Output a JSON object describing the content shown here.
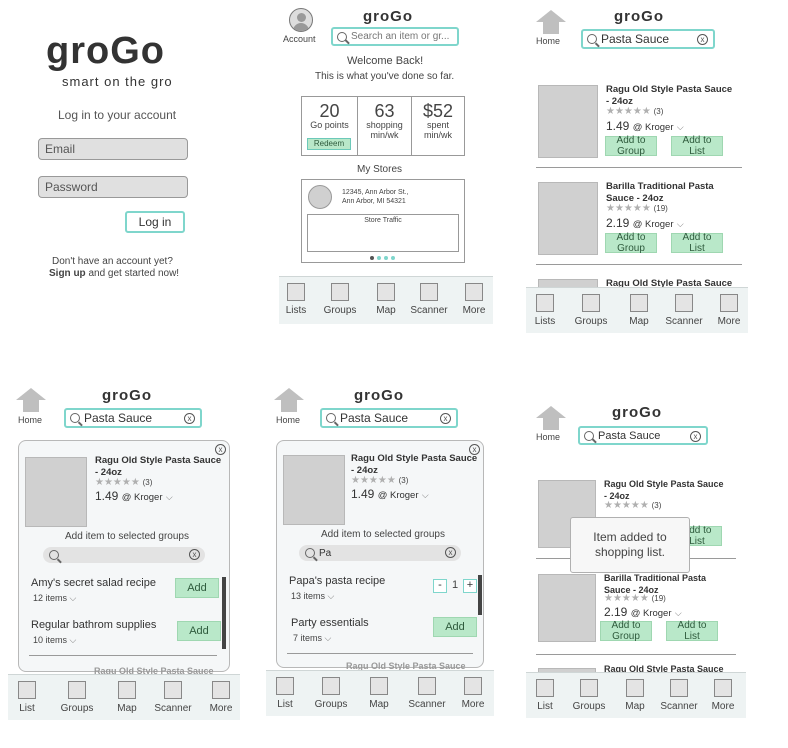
{
  "logo": {
    "main": "groGo",
    "tagline": "smart on the gro"
  },
  "login": {
    "heading": "Log in to your account",
    "email_placeholder": "Email",
    "password_placeholder": "Password",
    "button": "Log in",
    "no_account": "Don't have an account yet?",
    "signup_link": "Sign up",
    "signup_suffix": "and get started now!"
  },
  "home": {
    "account_label": "Account",
    "search_placeholder": "Search an item or gr...",
    "welcome": "Welcome Back!",
    "subtitle": "This is what you've done so far.",
    "stats": [
      {
        "value": "20",
        "label": "Go points"
      },
      {
        "value": "63",
        "label": "shopping",
        "unit": "min/wk"
      },
      {
        "value": "$52",
        "label": "spent",
        "unit": "min/wk"
      }
    ],
    "redeem": "Redeem",
    "my_stores": "My Stores",
    "store_address_1": "12345, Ann Arbor St.,",
    "store_address_2": "Ann Arbor, MI 54321",
    "store_traffic": "Store Traffic"
  },
  "search": {
    "home_label": "Home",
    "query": "Pasta Sauce",
    "query_partial": "Pa",
    "clear": "x"
  },
  "products": [
    {
      "name_1": "Ragu Old Style Pasta Sauce",
      "name_2": "- 24oz",
      "reviews": "(3)",
      "price": "1.49",
      "store": "@ Kroger"
    },
    {
      "name_1": "Barilla Traditional Pasta",
      "name_2": "Sauce - 24oz",
      "reviews": "(19)",
      "price": "2.19",
      "store": "@ Kroger"
    },
    {
      "name_1": "Ragu Old Style Pasta Sauce"
    }
  ],
  "stars": "★★★★★",
  "add_to_group": "Add to Group",
  "add_to_list": "Add to List",
  "add_panel": {
    "heading": "Add item to selected groups",
    "groups_a": [
      {
        "name": "Amy's secret salad recipe",
        "count": "12 items"
      },
      {
        "name": "Regular bathrom supplies",
        "count": "10 items"
      }
    ],
    "groups_b": [
      {
        "name": "Papa's pasta recipe",
        "count": "13 items",
        "qty": "1"
      },
      {
        "name": "Party essentials",
        "count": "7 items"
      }
    ],
    "add": "Add",
    "minus": "-",
    "plus": "+"
  },
  "toast": {
    "line1": "Item added to",
    "line2": "shopping list."
  },
  "tabs": {
    "lists": "Lists",
    "list": "List",
    "groups": "Groups",
    "map": "Map",
    "scanner": "Scanner",
    "more": "More"
  }
}
